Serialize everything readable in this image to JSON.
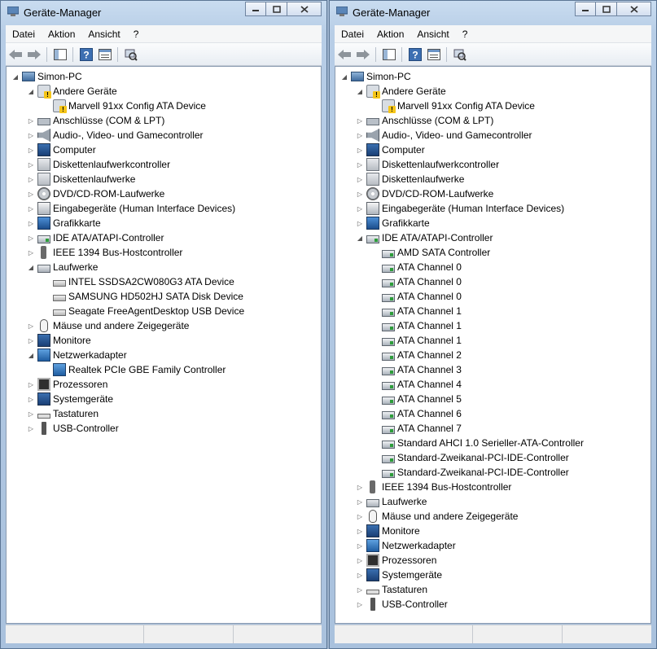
{
  "windows": [
    {
      "title": "Geräte-Manager",
      "menu": [
        "Datei",
        "Aktion",
        "Ansicht",
        "?"
      ],
      "tree": [
        {
          "label": "Simon-PC",
          "level": 0,
          "exp": "open",
          "icon": "computer-icon",
          "cls": "i-pc"
        },
        {
          "label": "Andere Geräte",
          "level": 1,
          "exp": "open",
          "icon": "unknown-device-icon",
          "cls": "i-dev i-warn"
        },
        {
          "label": "Marvell 91xx Config ATA Device",
          "level": 2,
          "exp": "none",
          "icon": "warning-device-icon",
          "cls": "i-dev i-warn"
        },
        {
          "label": "Anschlüsse (COM & LPT)",
          "level": 1,
          "exp": "closed",
          "icon": "port-icon",
          "cls": "i-port"
        },
        {
          "label": "Audio-, Video- und Gamecontroller",
          "level": 1,
          "exp": "closed",
          "icon": "speaker-icon",
          "cls": "i-audio"
        },
        {
          "label": "Computer",
          "level": 1,
          "exp": "closed",
          "icon": "computer-icon",
          "cls": "i-mon"
        },
        {
          "label": "Diskettenlaufwerkcontroller",
          "level": 1,
          "exp": "closed",
          "icon": "floppy-controller-icon",
          "cls": "i-gen"
        },
        {
          "label": "Diskettenlaufwerke",
          "level": 1,
          "exp": "closed",
          "icon": "floppy-drive-icon",
          "cls": "i-gen"
        },
        {
          "label": "DVD/CD-ROM-Laufwerke",
          "level": 1,
          "exp": "closed",
          "icon": "dvd-icon",
          "cls": "i-dvd"
        },
        {
          "label": "Eingabegeräte (Human Interface Devices)",
          "level": 1,
          "exp": "closed",
          "icon": "hid-icon",
          "cls": "i-hid"
        },
        {
          "label": "Grafikkarte",
          "level": 1,
          "exp": "closed",
          "icon": "display-adapter-icon",
          "cls": "i-gfx"
        },
        {
          "label": "IDE ATA/ATAPI-Controller",
          "level": 1,
          "exp": "closed",
          "icon": "ide-controller-icon",
          "cls": "i-ctrl"
        },
        {
          "label": "IEEE 1394 Bus-Hostcontroller",
          "level": 1,
          "exp": "closed",
          "icon": "firewire-icon",
          "cls": "i-1394"
        },
        {
          "label": "Laufwerke",
          "level": 1,
          "exp": "open",
          "icon": "disk-drive-icon",
          "cls": "i-disk"
        },
        {
          "label": "INTEL SSDSA2CW080G3 ATA Device",
          "level": 2,
          "exp": "none",
          "icon": "disk-drive-icon",
          "cls": "i-drive"
        },
        {
          "label": "SAMSUNG HD502HJ SATA Disk Device",
          "level": 2,
          "exp": "none",
          "icon": "disk-drive-icon",
          "cls": "i-drive"
        },
        {
          "label": "Seagate FreeAgentDesktop USB Device",
          "level": 2,
          "exp": "none",
          "icon": "disk-drive-icon",
          "cls": "i-drive"
        },
        {
          "label": "Mäuse und andere Zeigegeräte",
          "level": 1,
          "exp": "closed",
          "icon": "mouse-icon",
          "cls": "i-mouse"
        },
        {
          "label": "Monitore",
          "level": 1,
          "exp": "closed",
          "icon": "monitor-icon",
          "cls": "i-mon"
        },
        {
          "label": "Netzwerkadapter",
          "level": 1,
          "exp": "open",
          "icon": "network-adapter-icon",
          "cls": "i-net"
        },
        {
          "label": "Realtek PCIe GBE Family Controller",
          "level": 2,
          "exp": "none",
          "icon": "network-adapter-icon",
          "cls": "i-net"
        },
        {
          "label": "Prozessoren",
          "level": 1,
          "exp": "closed",
          "icon": "processor-icon",
          "cls": "i-cpu"
        },
        {
          "label": "Systemgeräte",
          "level": 1,
          "exp": "closed",
          "icon": "system-device-icon",
          "cls": "i-mon"
        },
        {
          "label": "Tastaturen",
          "level": 1,
          "exp": "closed",
          "icon": "keyboard-icon",
          "cls": "i-kbd"
        },
        {
          "label": "USB-Controller",
          "level": 1,
          "exp": "closed",
          "icon": "usb-icon",
          "cls": "i-usb"
        }
      ]
    },
    {
      "title": "Geräte-Manager",
      "menu": [
        "Datei",
        "Aktion",
        "Ansicht",
        "?"
      ],
      "tree": [
        {
          "label": "Simon-PC",
          "level": 0,
          "exp": "open",
          "icon": "computer-icon",
          "cls": "i-pc"
        },
        {
          "label": "Andere Geräte",
          "level": 1,
          "exp": "open",
          "icon": "unknown-device-icon",
          "cls": "i-dev i-warn"
        },
        {
          "label": "Marvell 91xx Config ATA Device",
          "level": 2,
          "exp": "none",
          "icon": "warning-device-icon",
          "cls": "i-dev i-warn"
        },
        {
          "label": "Anschlüsse (COM & LPT)",
          "level": 1,
          "exp": "closed",
          "icon": "port-icon",
          "cls": "i-port"
        },
        {
          "label": "Audio-, Video- und Gamecontroller",
          "level": 1,
          "exp": "closed",
          "icon": "speaker-icon",
          "cls": "i-audio"
        },
        {
          "label": "Computer",
          "level": 1,
          "exp": "closed",
          "icon": "computer-icon",
          "cls": "i-mon"
        },
        {
          "label": "Diskettenlaufwerkcontroller",
          "level": 1,
          "exp": "closed",
          "icon": "floppy-controller-icon",
          "cls": "i-gen"
        },
        {
          "label": "Diskettenlaufwerke",
          "level": 1,
          "exp": "closed",
          "icon": "floppy-drive-icon",
          "cls": "i-gen"
        },
        {
          "label": "DVD/CD-ROM-Laufwerke",
          "level": 1,
          "exp": "closed",
          "icon": "dvd-icon",
          "cls": "i-dvd"
        },
        {
          "label": "Eingabegeräte (Human Interface Devices)",
          "level": 1,
          "exp": "closed",
          "icon": "hid-icon",
          "cls": "i-hid"
        },
        {
          "label": "Grafikkarte",
          "level": 1,
          "exp": "closed",
          "icon": "display-adapter-icon",
          "cls": "i-gfx"
        },
        {
          "label": "IDE ATA/ATAPI-Controller",
          "level": 1,
          "exp": "open",
          "icon": "ide-controller-icon",
          "cls": "i-ctrl"
        },
        {
          "label": "AMD SATA Controller",
          "level": 2,
          "exp": "none",
          "icon": "ide-controller-icon",
          "cls": "i-ctrl"
        },
        {
          "label": "ATA Channel 0",
          "level": 2,
          "exp": "none",
          "icon": "ide-controller-icon",
          "cls": "i-ctrl"
        },
        {
          "label": "ATA Channel 0",
          "level": 2,
          "exp": "none",
          "icon": "ide-controller-icon",
          "cls": "i-ctrl"
        },
        {
          "label": "ATA Channel 0",
          "level": 2,
          "exp": "none",
          "icon": "ide-controller-icon",
          "cls": "i-ctrl"
        },
        {
          "label": "ATA Channel 1",
          "level": 2,
          "exp": "none",
          "icon": "ide-controller-icon",
          "cls": "i-ctrl"
        },
        {
          "label": "ATA Channel 1",
          "level": 2,
          "exp": "none",
          "icon": "ide-controller-icon",
          "cls": "i-ctrl"
        },
        {
          "label": "ATA Channel 1",
          "level": 2,
          "exp": "none",
          "icon": "ide-controller-icon",
          "cls": "i-ctrl"
        },
        {
          "label": "ATA Channel 2",
          "level": 2,
          "exp": "none",
          "icon": "ide-controller-icon",
          "cls": "i-ctrl"
        },
        {
          "label": "ATA Channel 3",
          "level": 2,
          "exp": "none",
          "icon": "ide-controller-icon",
          "cls": "i-ctrl"
        },
        {
          "label": "ATA Channel 4",
          "level": 2,
          "exp": "none",
          "icon": "ide-controller-icon",
          "cls": "i-ctrl"
        },
        {
          "label": "ATA Channel 5",
          "level": 2,
          "exp": "none",
          "icon": "ide-controller-icon",
          "cls": "i-ctrl"
        },
        {
          "label": "ATA Channel 6",
          "level": 2,
          "exp": "none",
          "icon": "ide-controller-icon",
          "cls": "i-ctrl"
        },
        {
          "label": "ATA Channel 7",
          "level": 2,
          "exp": "none",
          "icon": "ide-controller-icon",
          "cls": "i-ctrl"
        },
        {
          "label": "Standard AHCI 1.0 Serieller-ATA-Controller",
          "level": 2,
          "exp": "none",
          "icon": "ide-controller-icon",
          "cls": "i-ctrl"
        },
        {
          "label": "Standard-Zweikanal-PCI-IDE-Controller",
          "level": 2,
          "exp": "none",
          "icon": "ide-controller-icon",
          "cls": "i-ctrl"
        },
        {
          "label": "Standard-Zweikanal-PCI-IDE-Controller",
          "level": 2,
          "exp": "none",
          "icon": "ide-controller-icon",
          "cls": "i-ctrl"
        },
        {
          "label": "IEEE 1394 Bus-Hostcontroller",
          "level": 1,
          "exp": "closed",
          "icon": "firewire-icon",
          "cls": "i-1394"
        },
        {
          "label": "Laufwerke",
          "level": 1,
          "exp": "closed",
          "icon": "disk-drive-icon",
          "cls": "i-disk"
        },
        {
          "label": "Mäuse und andere Zeigegeräte",
          "level": 1,
          "exp": "closed",
          "icon": "mouse-icon",
          "cls": "i-mouse"
        },
        {
          "label": "Monitore",
          "level": 1,
          "exp": "closed",
          "icon": "monitor-icon",
          "cls": "i-mon"
        },
        {
          "label": "Netzwerkadapter",
          "level": 1,
          "exp": "closed",
          "icon": "network-adapter-icon",
          "cls": "i-net"
        },
        {
          "label": "Prozessoren",
          "level": 1,
          "exp": "closed",
          "icon": "processor-icon",
          "cls": "i-cpu"
        },
        {
          "label": "Systemgeräte",
          "level": 1,
          "exp": "closed",
          "icon": "system-device-icon",
          "cls": "i-mon"
        },
        {
          "label": "Tastaturen",
          "level": 1,
          "exp": "closed",
          "icon": "keyboard-icon",
          "cls": "i-kbd"
        },
        {
          "label": "USB-Controller",
          "level": 1,
          "exp": "closed",
          "icon": "usb-icon",
          "cls": "i-usb"
        }
      ]
    }
  ],
  "toolbar_icons": [
    "back-arrow-icon",
    "forward-arrow-icon",
    "show-hide-console-tree-icon",
    "help-icon",
    "properties-icon",
    "scan-hardware-icon"
  ],
  "colors": {
    "window_frame": "#b7cde6",
    "tree_bg": "#ffffff"
  }
}
